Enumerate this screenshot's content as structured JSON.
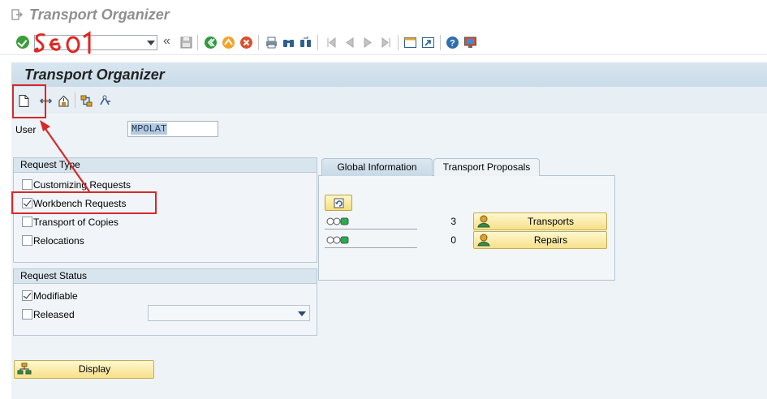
{
  "window": {
    "title": "Transport Organizer",
    "app_icon": "exit-door-icon"
  },
  "system_toolbar": {
    "command_field_value": "",
    "annotation_text": "SE 01",
    "icons": [
      "enter-check-icon",
      "collapse-double-arrow-icon",
      "save-icon",
      "back-icon",
      "exit-icon",
      "cancel-icon",
      "print-icon",
      "find-icon",
      "find-next-icon",
      "first-page-icon",
      "previous-page-icon",
      "next-page-icon",
      "last-page-icon",
      "new-session-icon",
      "shortcut-icon",
      "help-icon",
      "customize-layout-icon"
    ]
  },
  "screen": {
    "title": "Transport Organizer"
  },
  "app_toolbar": {
    "icons": [
      "create-request-icon",
      "display-change-icon",
      "release-icon",
      "transport-tools-icon",
      "settings-icon"
    ]
  },
  "user": {
    "label": "User",
    "value": "MPOLAT"
  },
  "request_type": {
    "title": "Request Type",
    "options": [
      {
        "label": "Customizing Requests",
        "checked": false
      },
      {
        "label": "Workbench Requests",
        "checked": true
      },
      {
        "label": "Transport of Copies",
        "checked": false
      },
      {
        "label": "Relocations",
        "checked": false
      }
    ]
  },
  "request_status": {
    "title": "Request Status",
    "options": [
      {
        "label": "Modifiable",
        "checked": true
      },
      {
        "label": "Released",
        "checked": false
      }
    ],
    "released_value": ""
  },
  "tabs": [
    {
      "label": "Global Information",
      "active": true
    },
    {
      "label": "Transport Proposals",
      "active": false
    }
  ],
  "global_info": {
    "refresh_icon": "refresh-icon",
    "rows": [
      {
        "count": "3",
        "button_label": "Transports",
        "status": "green"
      },
      {
        "count": "0",
        "button_label": "Repairs",
        "status": "green"
      }
    ]
  },
  "display_button": {
    "label": "Display"
  },
  "colors": {
    "title_area": "#d1e0eb",
    "button_yellow": "#f6e08a",
    "annotation_red": "#d42a2a",
    "light_green": "#22b14c"
  }
}
